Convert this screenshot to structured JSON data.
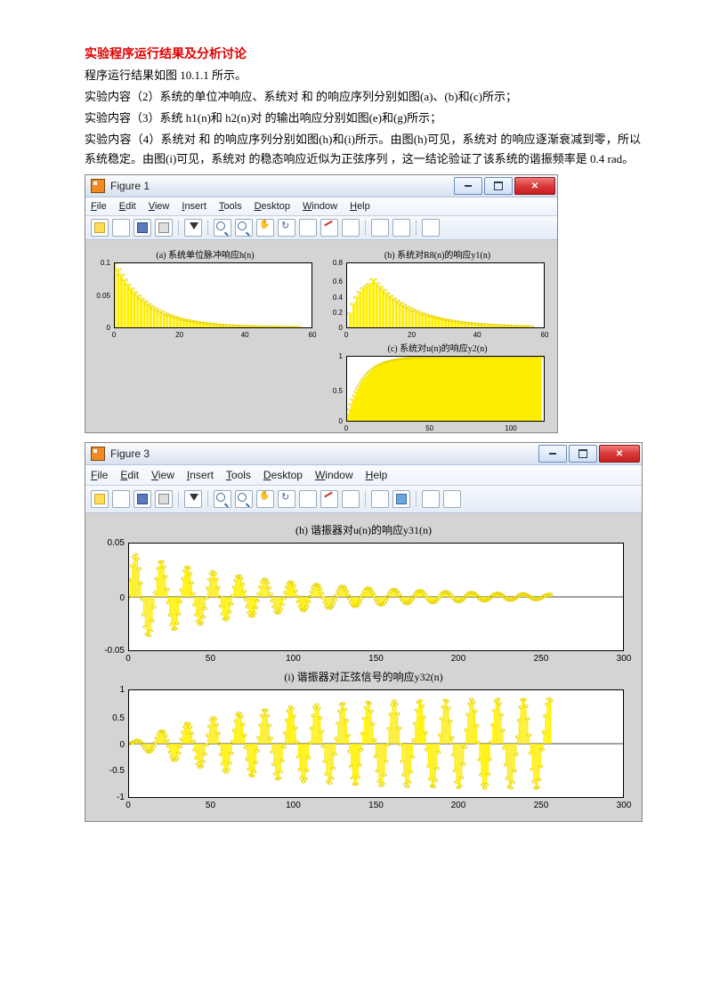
{
  "heading": "实验程序运行结果及分析讨论",
  "paras": [
    "程序运行结果如图 10.1.1 所示。",
    "实验内容（2）系统的单位冲响应、系统对 和 的响应序列分别如图(a)、(b)和(c)所示；",
    "实验内容（3）系统 h1(n)和 h2(n)对 的输出响应分别如图(e)和(g)所示；",
    "实验内容（4）系统对 和 的响应序列分别如图(h)和(i)所示。由图(h)可见，系统对 的响应逐渐衰减到零，所以系统稳定。由图(i)可见，系统对 的稳态响应近似为正弦序列 ，这一结论验证了该系统的谐振频率是 0.4 rad。"
  ],
  "window1": {
    "title": "Figure 1",
    "menus": [
      "File",
      "Edit",
      "View",
      "Insert",
      "Tools",
      "Desktop",
      "Window",
      "Help"
    ]
  },
  "window3": {
    "title": "Figure 3",
    "menus": [
      "File",
      "Edit",
      "View",
      "Insert",
      "Tools",
      "Desktop",
      "Window",
      "Help"
    ]
  },
  "chart_data": [
    {
      "id": "a",
      "type": "stem",
      "title": "(a) 系统单位脉冲响应h(n)",
      "xlim": [
        0,
        60
      ],
      "ylim": [
        0,
        0.1
      ],
      "xticks": [
        0,
        20,
        40,
        60
      ],
      "yticks": [
        0,
        0.05,
        0.1
      ]
    },
    {
      "id": "b",
      "type": "stem",
      "title": "(b) 系统对R8(n)的响应y1(n)",
      "xlim": [
        0,
        60
      ],
      "ylim": [
        0,
        0.8
      ],
      "xticks": [
        0,
        20,
        40,
        60
      ],
      "yticks": [
        0,
        0.2,
        0.4,
        0.6,
        0.8
      ]
    },
    {
      "id": "c",
      "type": "stem",
      "title": "(c) 系统对u(n)的响应y2(n)",
      "xlim": [
        0,
        120
      ],
      "ylim": [
        0,
        1
      ],
      "xticks": [
        0,
        50,
        100
      ],
      "yticks": [
        0,
        0.5,
        1
      ]
    },
    {
      "id": "h",
      "type": "stem-osc",
      "title": "(h) 谐振器对u(n)的响应y31(n)",
      "xlim": [
        0,
        300
      ],
      "ylim": [
        -0.05,
        0.05
      ],
      "xticks": [
        0,
        50,
        100,
        150,
        200,
        250,
        300
      ],
      "yticks": [
        -0.05,
        0,
        0.05
      ]
    },
    {
      "id": "i",
      "type": "stem-osc",
      "title": "(i) 谐振器对正弦信号的响应y32(n)",
      "xlim": [
        0,
        300
      ],
      "ylim": [
        -1,
        1
      ],
      "xticks": [
        0,
        50,
        100,
        150,
        200,
        250,
        300
      ],
      "yticks": [
        -1,
        -0.5,
        0,
        0.5,
        1
      ]
    }
  ]
}
